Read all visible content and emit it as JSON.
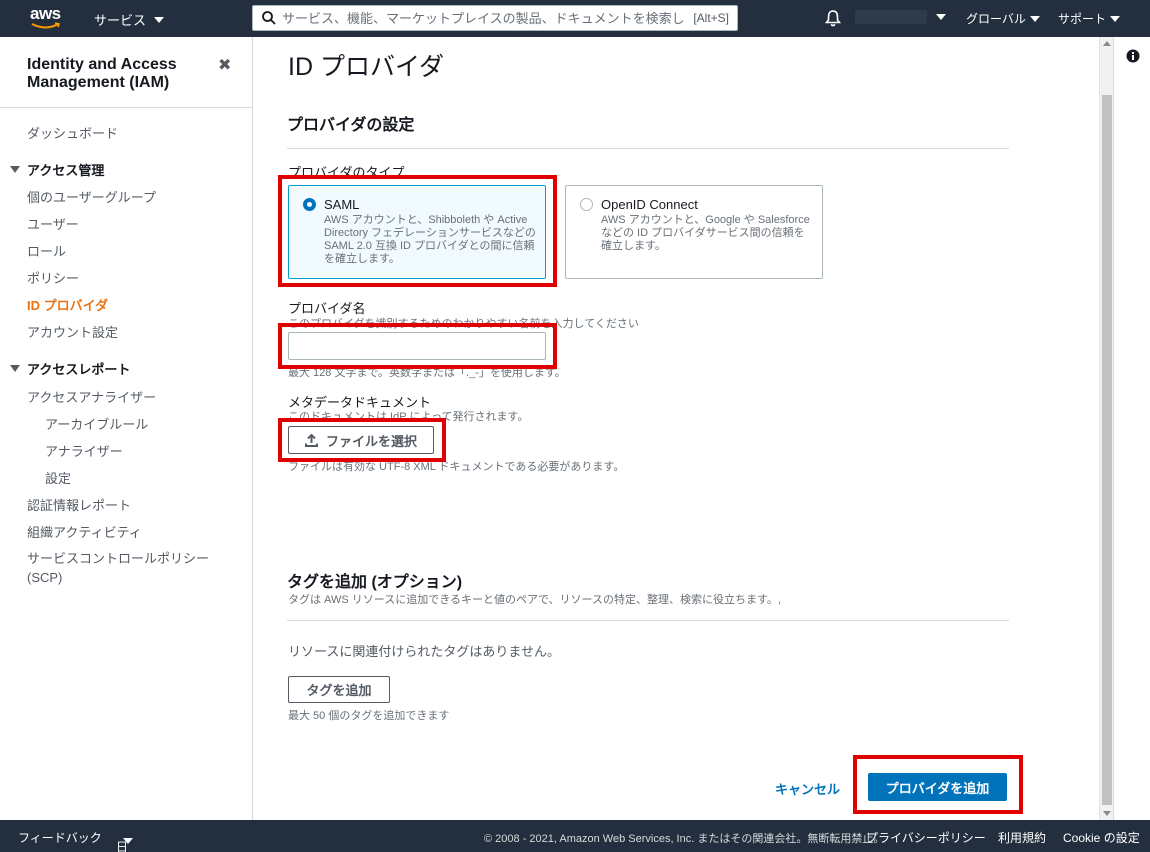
{
  "topnav": {
    "logo": "aws",
    "services_label": "サービス",
    "search_placeholder": "サービス、機能、マーケットプレイスの製品、ドキュメントを検索し",
    "search_shortcut": "[Alt+S]",
    "region_label": "グローバル",
    "support_label": "サポート",
    "icons": [
      "search-icon",
      "bell-icon",
      "chevron-down-icon"
    ]
  },
  "sidebar": {
    "title": "Identity and Access Management (IAM)",
    "close": "✖",
    "dashboard": "ダッシュボード",
    "access_mgmt": {
      "label": "アクセス管理",
      "items": [
        "個のユーザーグループ",
        "ユーザー",
        "ロール",
        "ポリシー",
        "ID プロバイダ",
        "アカウント設定"
      ]
    },
    "access_reports": {
      "label": "アクセスレポート",
      "items": [
        "アクセスアナライザー",
        "アーカイブルール",
        "アナライザー",
        "設定",
        "認証情報レポート",
        "組織アクティビティ",
        "サービスコントロールポリシー (SCP)"
      ]
    },
    "active_item": "ID プロバイダ"
  },
  "main": {
    "page_title": "ID プロバイダ",
    "provider_settings": {
      "title": "プロバイダの設定",
      "type_label": "プロバイダのタイプ",
      "types": [
        {
          "name": "SAML",
          "desc": "AWS アカウントと、Shibboleth や Active Directory フェデレーションサービスなどの SAML 2.0 互換 ID プロバイダとの間に信頼を確立します。",
          "selected": true
        },
        {
          "name": "OpenID Connect",
          "desc": "AWS アカウントと、Google や Salesforce などの ID プロバイダサービス間の信頼を確立します。",
          "selected": false
        }
      ],
      "name_label": "プロバイダ名",
      "name_desc": "このプロバイダを識別するためのわかりやすい名前を入力してください",
      "name_value": "",
      "name_constraint": "最大 128 文字まで。英数字または「._-」を使用します。",
      "metadata_label": "メタデータドキュメント",
      "metadata_desc": "このドキュメントは IdP によって発行されます。",
      "choose_file_button": "ファイルを選択",
      "metadata_constraint": "ファイルは有効な UTF-8 XML ドキュメントである必要があります。"
    },
    "tags": {
      "title": "タグを追加 (オプション)",
      "desc": "タグは AWS リソースに追加できるキーと値のペアで、リソースの特定、整理、検索に役立ちます。,",
      "empty": "リソースに関連付けられたタグはありません。",
      "add_button": "タグを追加",
      "limit": "最大 50 個のタグを追加できます"
    },
    "cancel_button": "キャンセル",
    "submit_button": "プロバイダを追加"
  },
  "footer": {
    "feedback": "フィードバック",
    "language": "日本語",
    "copyright": "© 2008 - 2021, Amazon Web Services, Inc. またはその関連会社。無断転用禁止。",
    "privacy": "プライバシーポリシー",
    "terms": "利用規約",
    "cookie": "Cookie の設定"
  },
  "colors": {
    "nav_bg": "#232f3e",
    "accent_orange": "#ec7211",
    "primary_blue": "#0073bb",
    "highlight_red": "#e00000"
  }
}
